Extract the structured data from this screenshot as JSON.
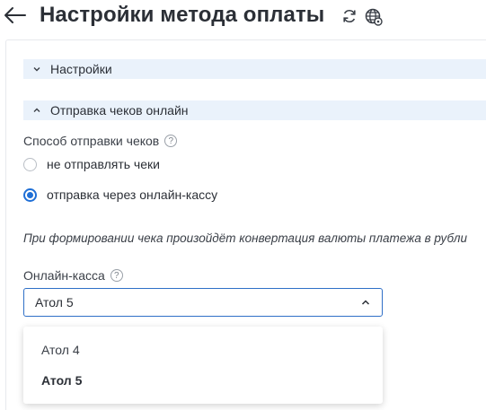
{
  "header": {
    "title": "Настройки метода оплаты",
    "back_icon": "arrow-left-icon",
    "refresh_icon": "refresh-icon",
    "globe_icon": "globe-settings-icon"
  },
  "sections": {
    "settings": {
      "label": "Настройки",
      "state": "collapsed"
    },
    "receipts": {
      "label": "Отправка чеков онлайн",
      "state": "expanded"
    }
  },
  "receipt_method": {
    "label": "Способ отправки чеков",
    "help": "?",
    "options": [
      {
        "label": "не отправлять чеки",
        "checked": false
      },
      {
        "label": "отправка через онлайн-кассу",
        "checked": true
      }
    ]
  },
  "note": "При формировании чека произойдёт конвертация валюты платежа в рубли",
  "cashbox": {
    "label": "Онлайн-касса",
    "help": "?",
    "selected": "Атол 5",
    "options": [
      "Атол 4",
      "Атол 5"
    ]
  },
  "colors": {
    "accent": "#1f6fd6",
    "section_bg": "#eaf2fb",
    "text": "#2b2f36"
  }
}
